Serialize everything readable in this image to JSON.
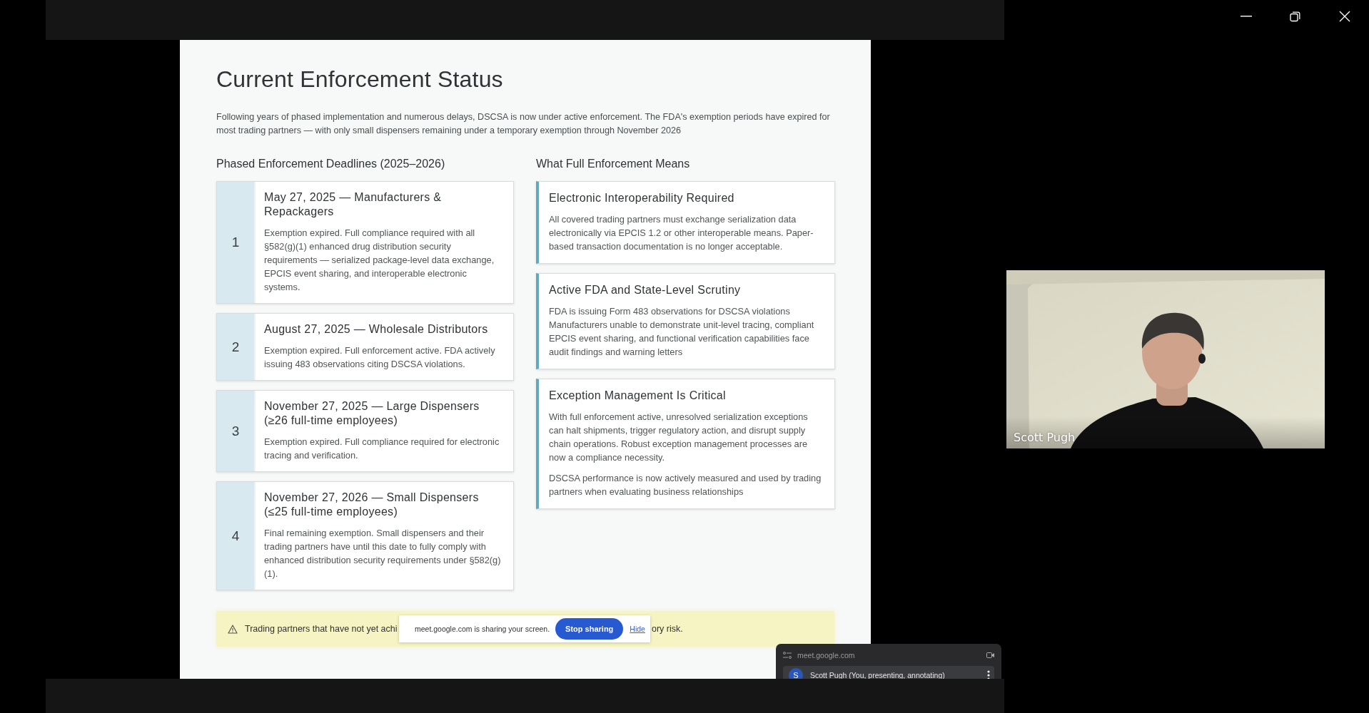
{
  "slide": {
    "title": "Current Enforcement Status",
    "intro": "Following years of phased implementation and numerous delays, DSCSA is now under active enforcement. The FDA's exemption periods have expired for most trading partners — with only small dispensers remaining under a temporary exemption through November 2026",
    "deadlines": {
      "heading": "Phased Enforcement Deadlines (2025–2026)",
      "items": [
        {
          "number": "1",
          "title": "May 27, 2025 — Manufacturers & Repackagers",
          "body": "Exemption expired. Full compliance required with all §582(g)(1) enhanced drug distribution security requirements — serialized package-level data exchange, EPCIS event sharing, and interoperable electronic systems."
        },
        {
          "number": "2",
          "title": "August 27, 2025 — Wholesale Distributors",
          "body": "Exemption expired. Full enforcement active. FDA actively issuing 483 observations citing DSCSA violations."
        },
        {
          "number": "3",
          "title": "November 27, 2025 — Large Dispensers (≥26 full-time employees)",
          "body": "Exemption expired. Full compliance required for electronic tracing and verification."
        },
        {
          "number": "4",
          "title": "November 27, 2026 — Small Dispensers (≤25 full-time employees)",
          "body": "Final remaining exemption. Small dispensers and their trading partners have until this date to fully comply with enhanced distribution security requirements under §582(g)(1)."
        }
      ]
    },
    "means": {
      "heading": "What Full Enforcement Means",
      "items": [
        {
          "title": "Electronic Interoperability Required",
          "paragraphs": [
            "All covered trading partners must exchange serialization data electronically via EPCIS 1.2 or other interoperable means. Paper-based transaction documentation is no longer acceptable."
          ]
        },
        {
          "title": "Active FDA and State-Level Scrutiny",
          "paragraphs": [
            "FDA is issuing Form 483 observations for DSCSA violations Manufacturers unable to demonstrate unit-level tracing, compliant EPCIS event sharing, and functional verification capabilities face audit findings and warning letters"
          ]
        },
        {
          "title": "Exception Management Is Critical",
          "paragraphs": [
            "With full enforcement active, unresolved serialization exceptions can halt shipments, trigger regulatory action, and disrupt supply chain operations. Robust exception management processes are now a compliance necessity.",
            "DSCSA performance is now actively measured and used by trading partners when evaluating business relationships"
          ]
        }
      ]
    },
    "alert": {
      "text_before": "Trading partners that have not yet achi",
      "text_after": "ory risk."
    }
  },
  "share_bar": {
    "message": "meet.google.com is sharing your screen.",
    "stop_button": "Stop sharing",
    "hide_link": "Hide"
  },
  "video_tile": {
    "name": "Scott Pugh"
  },
  "meet_popup": {
    "site": "meet.google.com",
    "participant": {
      "initial": "S",
      "name": "Scott Pugh (You, presenting, annotating)"
    }
  }
}
